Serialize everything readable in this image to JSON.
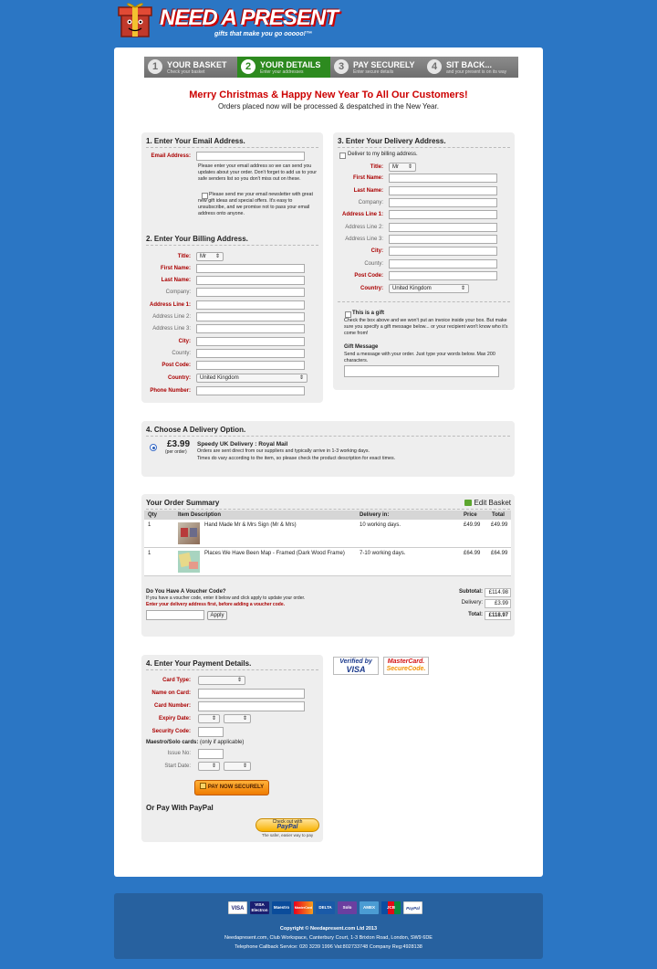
{
  "brand": {
    "name": "NEED A PRESENT",
    "tagline": "gifts that make you go ooooo!™"
  },
  "steps": [
    {
      "num": "1",
      "label": "YOUR BASKET",
      "sub": "Check your basket",
      "active": false
    },
    {
      "num": "2",
      "label": "YOUR DETAILS",
      "sub": "Enter your addresses",
      "active": true
    },
    {
      "num": "3",
      "label": "PAY SECURELY",
      "sub": "Enter secure details",
      "active": false
    },
    {
      "num": "4",
      "label": "SIT BACK...",
      "sub": "and your present is on its way",
      "active": false
    }
  ],
  "notice": {
    "title": "Merry Christmas & Happy New Year To All Our Customers!",
    "subtitle": "Orders placed now will be processed & despatched in the New Year."
  },
  "email_section": {
    "heading": "1. Enter Your Email Address.",
    "email_label": "Email Address:",
    "help": "Please enter your email address so we can send you updates about your order. Don't forget to add us to your safe senders list so you don't miss out on these.",
    "newsletter": "Please send me your email newsletter with great new gift ideas and special offers. It's easy to unsubscribe, and we promise not to pass your email address onto anyone."
  },
  "billing": {
    "heading": "2. Enter Your Billing Address.",
    "title_label": "Title:",
    "title_value": "Mr",
    "first_name": "First Name:",
    "last_name": "Last Name:",
    "company": "Company:",
    "address1": "Address Line 1:",
    "address2": "Address Line 2:",
    "address3": "Address Line 3:",
    "city": "City:",
    "county": "County:",
    "postcode": "Post Code:",
    "country": "Country:",
    "country_value": "United Kingdom",
    "phone": "Phone Number:"
  },
  "delivery": {
    "heading": "3. Enter Your Delivery Address.",
    "same_as_billing": "Deliver to my billing address.",
    "title_label": "Title:",
    "title_value": "Mr",
    "first_name": "First Name:",
    "last_name": "Last Name:",
    "company": "Company:",
    "address1": "Address Line 1:",
    "address2": "Address Line 2:",
    "address3": "Address Line 3:",
    "city": "City:",
    "county": "County:",
    "postcode": "Post Code:",
    "country": "Country:",
    "country_value": "United Kingdom",
    "gift_label": "This is a gift",
    "gift_help": "Check the box above and we won't put an invoice inside your box. But make sure you specify a gift message below... or your recipient won't know who it's come from!",
    "gift_message_title": "Gift Message",
    "gift_message_help": "Send a message with your order. Just type your words below. Max 200 characters."
  },
  "delivery_option": {
    "heading": "4. Choose A Delivery Option.",
    "price": "£3.99",
    "per": "(per order)",
    "name": "Speedy UK Delivery : Royal Mail",
    "desc1": "Orders are sent direct from our suppliers and typically arrive in 1-3 working days.",
    "desc2": "Times do vary according to the item, so please check the product description for exact times."
  },
  "summary": {
    "heading": "Your Order Summary",
    "edit": "Edit Basket",
    "columns": {
      "qty": "Qty",
      "desc": "Item Description",
      "delivery": "Delivery in:",
      "price": "Price",
      "total": "Total"
    },
    "rows": [
      {
        "qty": "1",
        "desc": "Hand Made Mr & Mrs Sign (Mr & Mrs)",
        "delivery": "10 working days.",
        "price": "£49.99",
        "total": "£49.99"
      },
      {
        "qty": "1",
        "desc": "Places We Have Been Map - Framed (Dark Wood Frame)",
        "delivery": "7-10 working days.",
        "price": "£64.99",
        "total": "£64.99"
      }
    ],
    "voucher_title": "Do You Have A Voucher Code?",
    "voucher_help": "If you have a voucher code, enter it below and click apply to update your order.",
    "voucher_warning": "Enter your delivery address first, before adding a voucher code.",
    "apply": "Apply",
    "subtotal_label": "Subtotal:",
    "subtotal": "£114.98",
    "delivery_label": "Delivery:",
    "delivery_cost": "£3.99",
    "total_label": "Total:",
    "total": "£118.97"
  },
  "payment": {
    "heading": "4. Enter Your Payment Details.",
    "card_type": "Card Type:",
    "name_on_card": "Name on Card:",
    "card_number": "Card Number:",
    "expiry": "Expiry Date:",
    "security": "Security Code:",
    "maestro": "Maestro/Solo cards:",
    "maestro_note": "(only if applicable)",
    "issue": "Issue No:",
    "start": "Start Date:",
    "pay_now": "PAY NOW SECURELY",
    "paypal_heading": "Or Pay With PayPal",
    "paypal_btn_top": "Check out with",
    "paypal_brand": "PayPal",
    "paypal_caption": "The safer, easier way to pay"
  },
  "badges": {
    "visa_top": "Verified by",
    "visa_bottom": "VISA",
    "mc_top": "MasterCard.",
    "mc_bottom": "SecureCode."
  },
  "footer": {
    "cards": [
      "VISA",
      "VISA Electron",
      "Maestro",
      "MasterCard",
      "DELTA",
      "Solo",
      "AMEX",
      "JCB",
      "PayPal"
    ],
    "copyright": "Copyright © Needapresent.com Ltd 2013",
    "address": "Needapresent.com, Club Workspace, Canterbury Court, 1-3 Brixton Road, London, SW9 6DE",
    "contact": "Telephone Callback Service: 020 3239 1996   Vat:802733748   Company Reg:4928138"
  },
  "colors": {
    "background": "#2b76c4",
    "accent_red": "#cc0000",
    "step_active": "#2d8a1f",
    "pay_button": "#ef7c00"
  }
}
